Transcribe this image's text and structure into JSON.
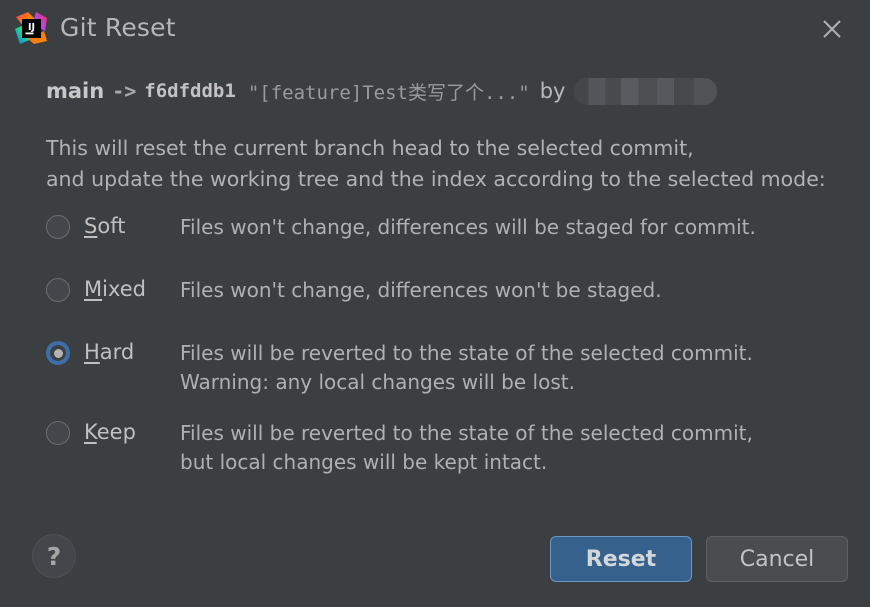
{
  "window": {
    "title": "Git Reset",
    "app_icon": "intellij-idea-icon",
    "close_icon": "close-icon"
  },
  "commit": {
    "branch": "main",
    "arrow": "->",
    "hash": "f6dfddb1",
    "subject": "\"[feature]Test类写了个...\"",
    "by_label": "by",
    "author": "",
    "author_redacted": true
  },
  "description": {
    "line1": "This will reset the current branch head to the selected commit,",
    "line2": "and update the working tree and the index according to the selected mode:"
  },
  "modes": {
    "selected": "Hard",
    "options": [
      {
        "id": "soft",
        "mnemonic": "S",
        "label_rest": "oft",
        "selected": false,
        "desc_line1": "Files won't change, differences will be staged for commit.",
        "desc_line2": ""
      },
      {
        "id": "mixed",
        "mnemonic": "M",
        "label_rest": "ixed",
        "selected": false,
        "desc_line1": "Files won't change, differences won't be staged.",
        "desc_line2": ""
      },
      {
        "id": "hard",
        "mnemonic": "H",
        "label_rest": "ard",
        "selected": true,
        "desc_line1": "Files will be reverted to the state of the selected commit.",
        "desc_line2": "Warning: any local changes will be lost."
      },
      {
        "id": "keep",
        "mnemonic": "K",
        "label_rest": "eep",
        "selected": false,
        "desc_line1": "Files will be reverted to the state of the selected commit,",
        "desc_line2": "but local changes will be kept intact."
      }
    ]
  },
  "footer": {
    "help_label": "?",
    "reset_label": "Reset",
    "cancel_label": "Cancel"
  },
  "colors": {
    "background": "#3c3f41",
    "text": "#b2b2b2",
    "accent_blue": "#3e6ea8",
    "default_button": "#37618d",
    "default_button_border": "#6a98c4",
    "plain_button": "#4a4d50"
  }
}
